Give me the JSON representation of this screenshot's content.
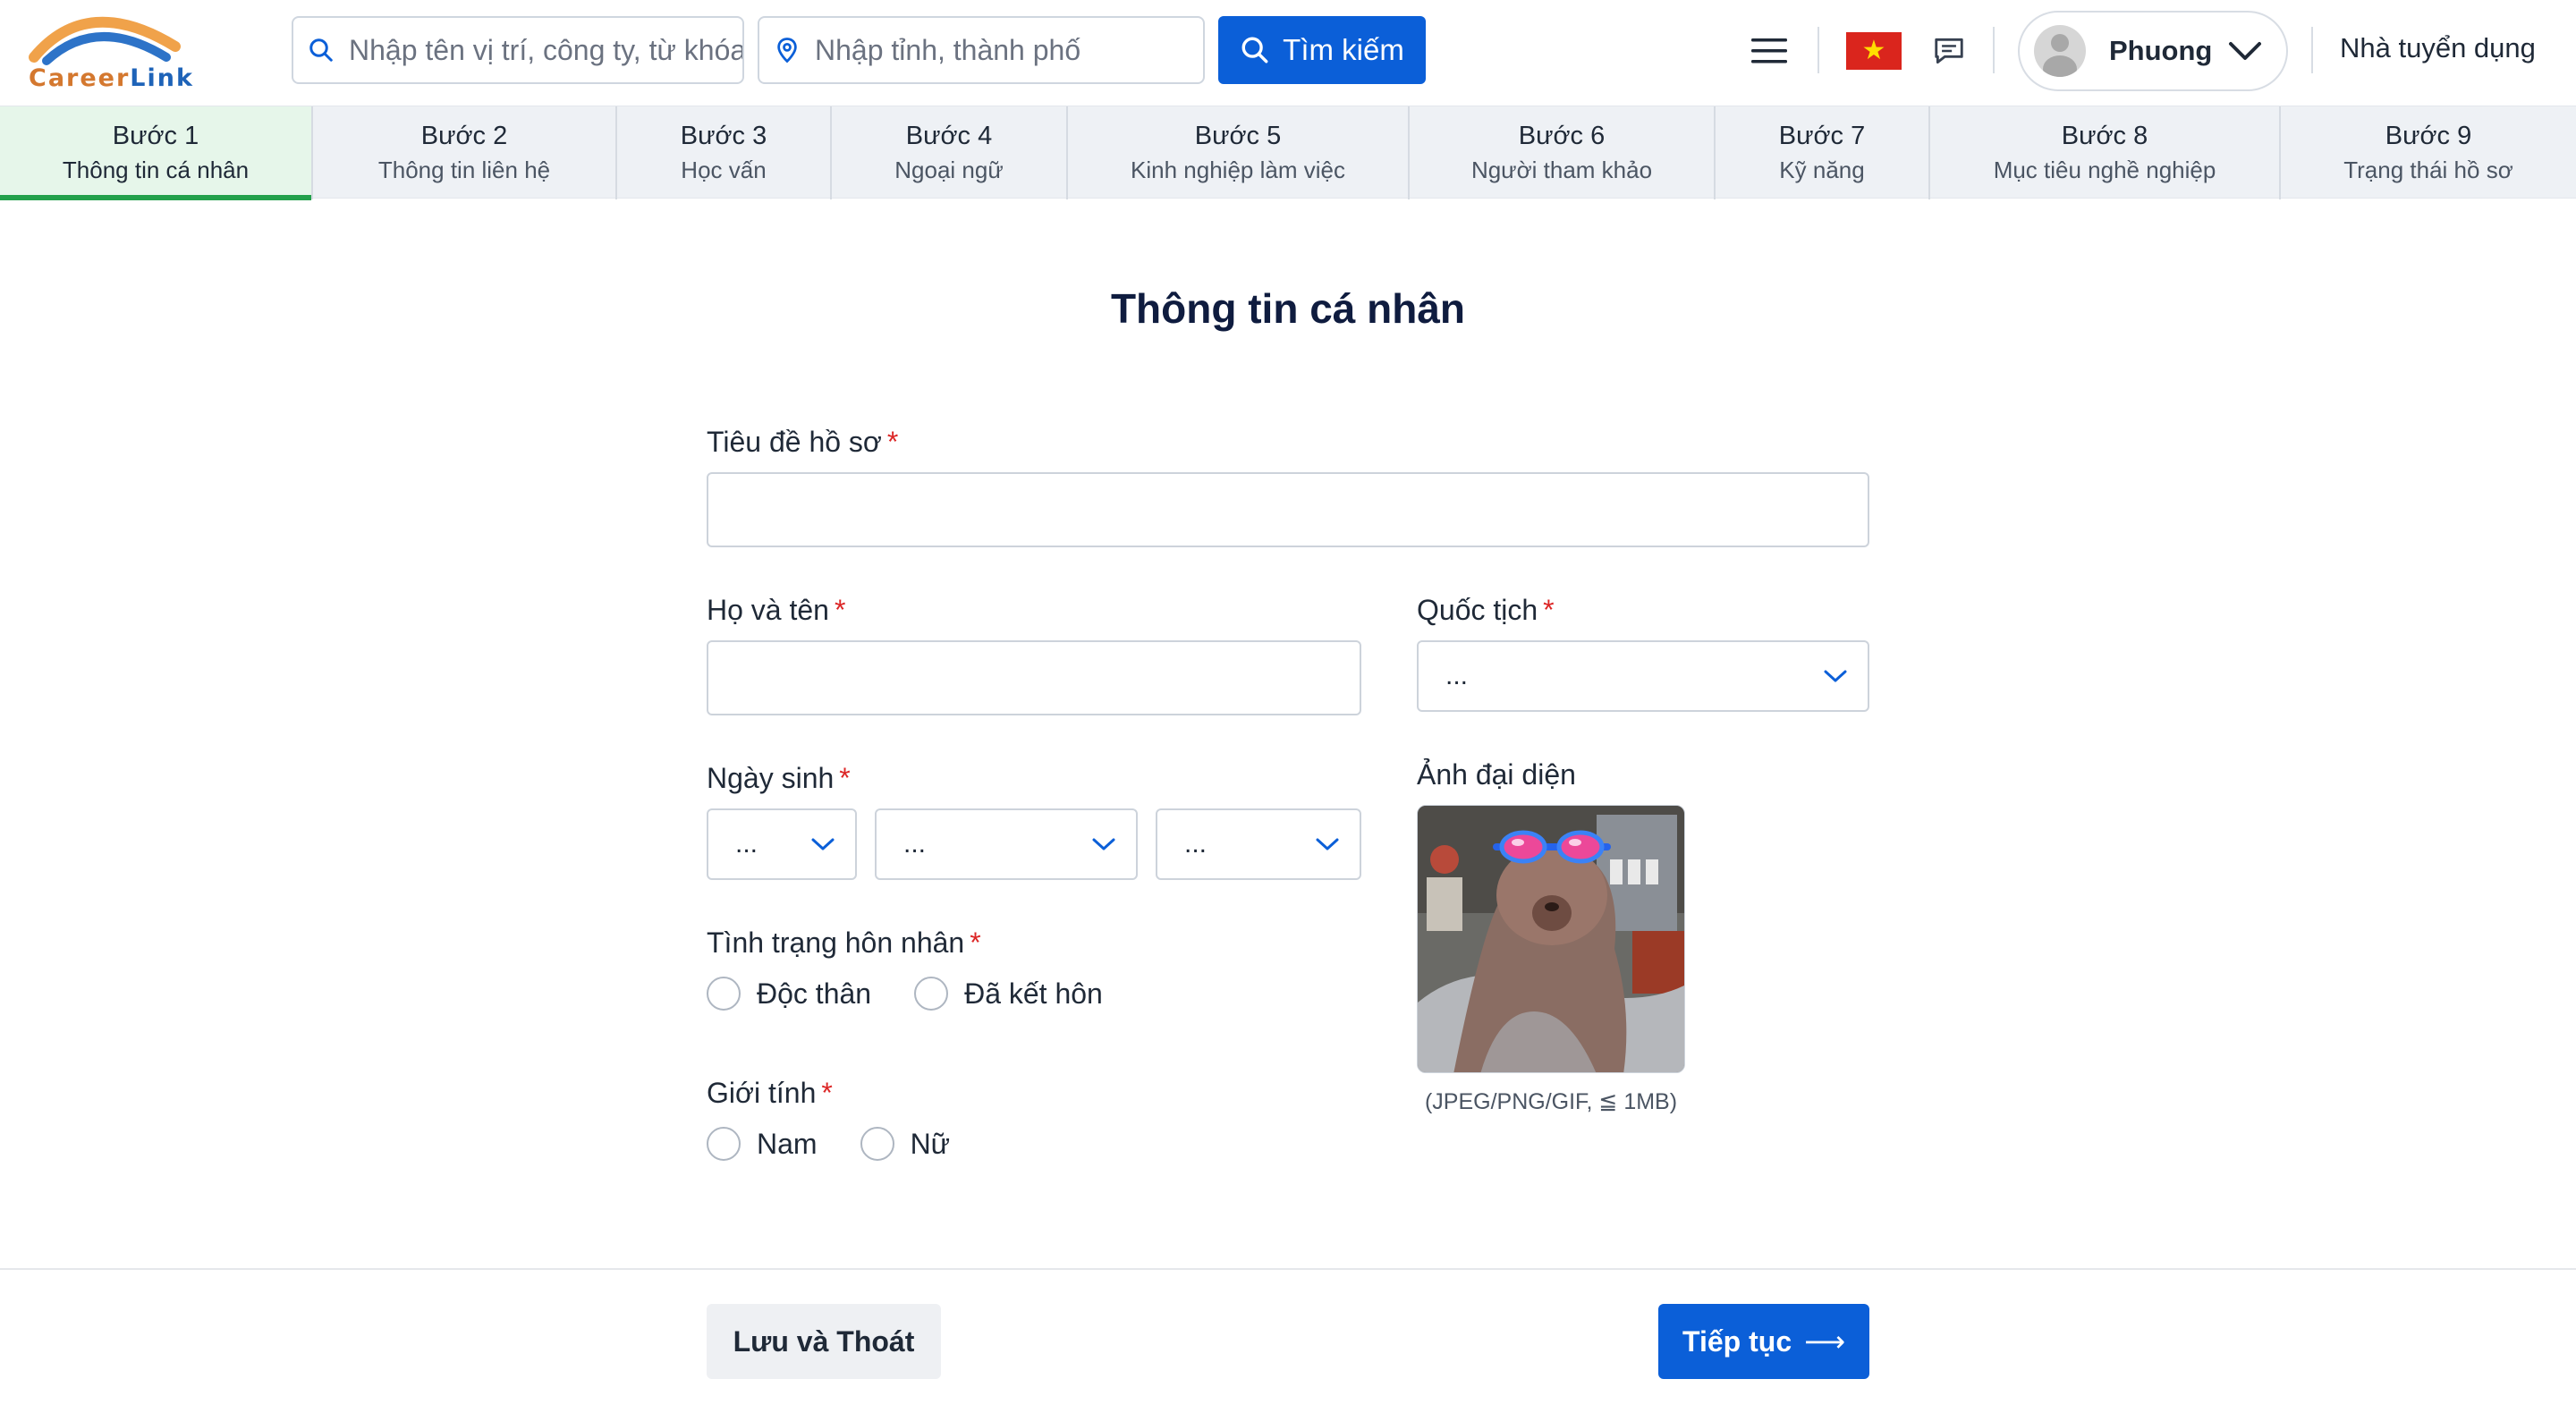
{
  "header": {
    "logo_text_part1": "Career",
    "logo_text_part2": "Link",
    "search_keyword_placeholder": "Nhập tên vị trí, công ty, từ khóa",
    "search_location_placeholder": "Nhập tỉnh, thành phố",
    "search_button": "Tìm kiếm",
    "flag_star": "★",
    "user_name": "Phuong",
    "employer_link": "Nhà tuyển dụng",
    "icons": [
      "logo-arc",
      "search-icon",
      "location-pin-icon",
      "menu-icon",
      "vietnam-flag-icon",
      "chat-icon",
      "user-avatar-icon",
      "chevron-down-icon"
    ]
  },
  "steps": [
    {
      "num": "Bước 1",
      "label": "Thông tin cá nhân",
      "active": true
    },
    {
      "num": "Bước 2",
      "label": "Thông tin liên hệ"
    },
    {
      "num": "Bước 3",
      "label": "Học vấn"
    },
    {
      "num": "Bước 4",
      "label": "Ngoại ngữ"
    },
    {
      "num": "Bước 5",
      "label": "Kinh nghiệp làm việc"
    },
    {
      "num": "Bước 6",
      "label": "Người tham khảo"
    },
    {
      "num": "Bước 7",
      "label": "Kỹ năng"
    },
    {
      "num": "Bước 8",
      "label": "Mục tiêu nghề nghiệp"
    },
    {
      "num": "Bước 9",
      "label": "Trạng thái hồ sơ"
    }
  ],
  "form": {
    "title": "Thông tin cá nhân",
    "required_mark": "*",
    "profile_title_label": "Tiêu đề hồ sơ",
    "profile_title_value": "",
    "full_name_label": "Họ và tên",
    "full_name_value": "",
    "nationality_label": "Quốc tịch",
    "nationality_value": "...",
    "birthdate_label": "Ngày sinh",
    "birth_day": "...",
    "birth_month": "...",
    "birth_year": "...",
    "photo_label": "Ảnh đại diện",
    "photo_hint": "(JPEG/PNG/GIF, ≦ 1MB)",
    "marital_label": "Tình trạng hôn nhân",
    "marital_options": [
      "Độc thân",
      "Đã kết hôn"
    ],
    "gender_label": "Giới tính",
    "gender_options": [
      "Nam",
      "Nữ"
    ]
  },
  "footer": {
    "save_exit": "Lưu và Thoát",
    "continue": "Tiếp tục",
    "continue_arrow": "⟶"
  },
  "colors": {
    "primary": "#0b5fd8",
    "active_step_bg": "#e6f6ea",
    "active_step_bar": "#22a04b",
    "required": "#dc2626"
  }
}
